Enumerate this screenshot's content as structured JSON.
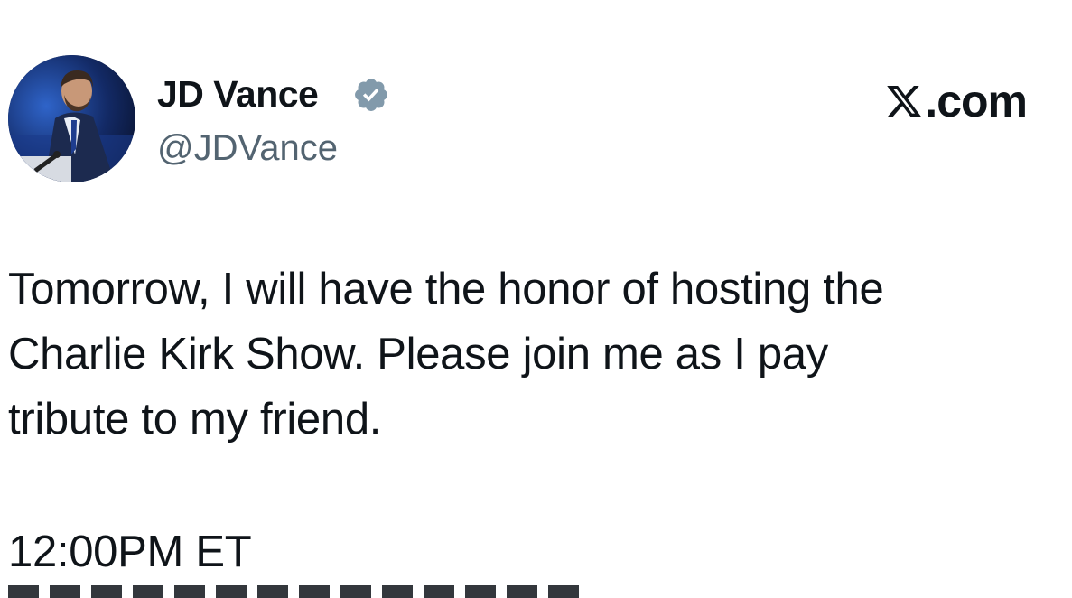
{
  "author": {
    "display_name": "JD Vance",
    "handle": "@JDVance",
    "verified": true,
    "avatar_icon": "profile-photo-icon",
    "verified_icon": "verified-badge-icon",
    "verified_color": "#829aab"
  },
  "brand": {
    "logo_icon": "x-logo-icon",
    "suffix": ".com"
  },
  "tweet": {
    "text": "Tomorrow, I will have the honor of hosting the\nCharlie Kirk Show. Please join me as I pay\ntribute to my friend.",
    "time": "12:00PM ET"
  },
  "colors": {
    "text": "#0f1419",
    "secondary_text": "#536471",
    "background": "#ffffff"
  }
}
